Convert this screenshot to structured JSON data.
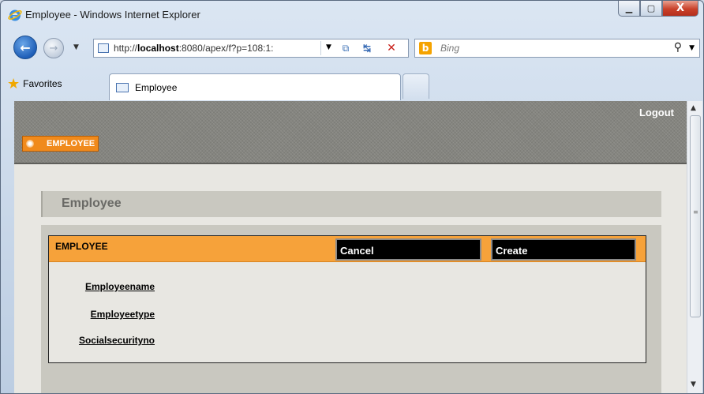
{
  "window": {
    "title": "Employee - Windows Internet Explorer",
    "minimize_glyph": "▁",
    "maximize_glyph": "▢",
    "close_glyph": "X"
  },
  "navigation": {
    "url_prefix": "http://",
    "url_host": "localhost",
    "url_rest": ":8080/apex/f?p=108:1:",
    "search_placeholder": "Bing"
  },
  "favorites_bar": {
    "favorites_label": "Favorites",
    "tabs": [
      {
        "label": "Employee"
      }
    ]
  },
  "page": {
    "header": {
      "logout_label": "Logout",
      "app_tab_label": "EMPLOYEE"
    },
    "region": {
      "title": "Employee"
    },
    "form": {
      "title": "EMPLOYEE",
      "cancel_label": "Cancel",
      "create_label": "Create",
      "fields": [
        {
          "label": "Employeename",
          "value": ""
        },
        {
          "label": "Employeetype",
          "value": ""
        },
        {
          "label": "Socialsecurityno",
          "value": ""
        }
      ]
    }
  },
  "colors": {
    "accent_orange": "#f6a23a",
    "header_gray": "#858580",
    "region_gray": "#c9c8c0",
    "button_black": "#000000"
  },
  "icons": [
    "ie-logo-icon",
    "back-arrow-icon",
    "forward-arrow-icon",
    "page-icon",
    "compatibility-icon",
    "refresh-icon",
    "stop-icon",
    "bing-icon",
    "search-icon",
    "favorites-star-icon"
  ]
}
